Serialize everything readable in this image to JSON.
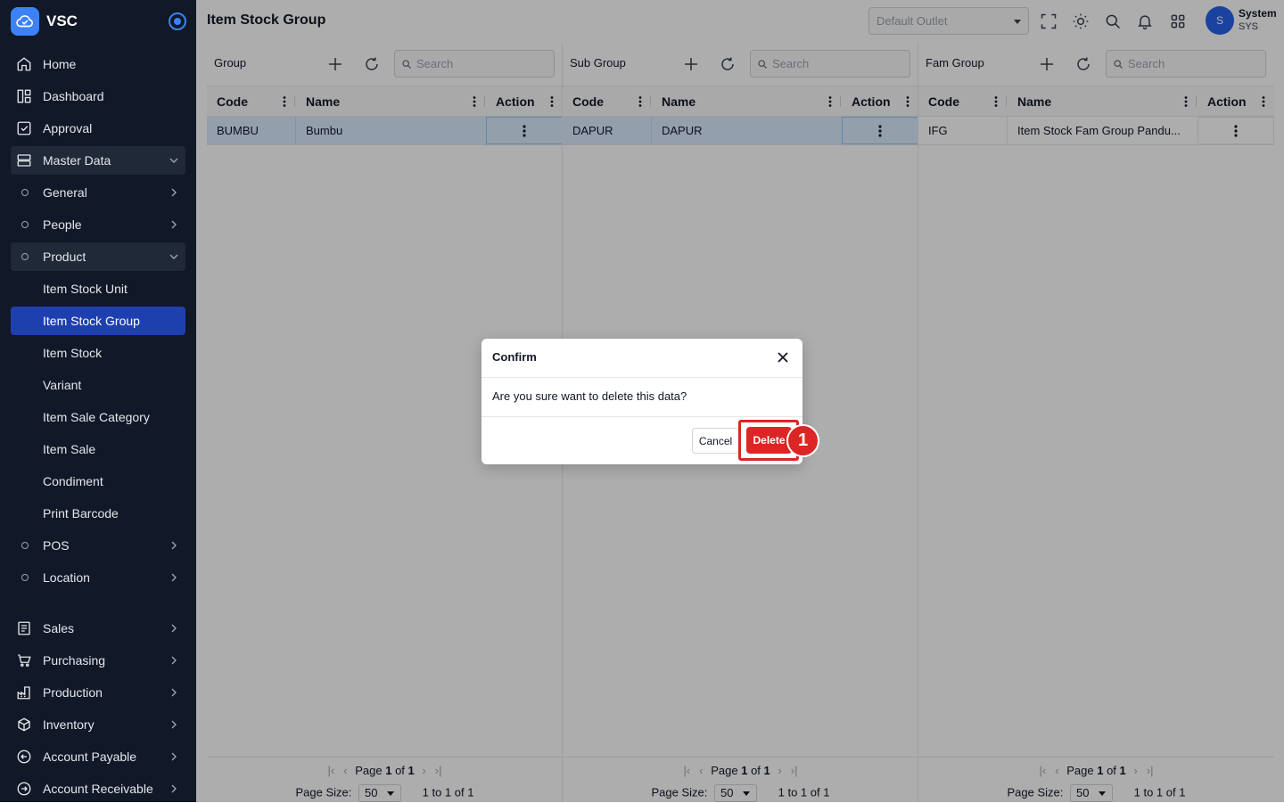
{
  "app": {
    "name": "VSC"
  },
  "sidebar": {
    "items": [
      {
        "label": "Home",
        "icon": "home-icon"
      },
      {
        "label": "Dashboard",
        "icon": "dashboard-icon"
      },
      {
        "label": "Approval",
        "icon": "approval-icon"
      },
      {
        "label": "Master Data",
        "icon": "master-data-icon"
      },
      {
        "label": "General"
      },
      {
        "label": "People"
      },
      {
        "label": "Product"
      },
      {
        "label": "Item Stock Unit"
      },
      {
        "label": "Item Stock Group"
      },
      {
        "label": "Item Stock"
      },
      {
        "label": "Variant"
      },
      {
        "label": "Item Sale Category"
      },
      {
        "label": "Item Sale"
      },
      {
        "label": "Condiment"
      },
      {
        "label": "Print Barcode"
      },
      {
        "label": "POS"
      },
      {
        "label": "Location"
      },
      {
        "label": "Sales",
        "icon": "sales-icon"
      },
      {
        "label": "Purchasing",
        "icon": "cart-icon"
      },
      {
        "label": "Production",
        "icon": "production-icon"
      },
      {
        "label": "Inventory",
        "icon": "box-icon"
      },
      {
        "label": "Account Payable",
        "icon": "arrow-left-circle-icon"
      },
      {
        "label": "Account Receivable",
        "icon": "arrow-right-circle-icon"
      }
    ]
  },
  "header": {
    "title": "Item Stock Group",
    "outlet_placeholder": "Default Outlet",
    "user": {
      "initial": "S",
      "name": "System",
      "code": "SYS"
    }
  },
  "panels": [
    {
      "title": "Group",
      "search_placeholder": "Search",
      "columns": [
        "Code",
        "Name",
        "Action"
      ],
      "rows": [
        {
          "code": "BUMBU",
          "name": "Bumbu"
        }
      ],
      "pager": {
        "page_prefix": "Page",
        "page": "1",
        "of": "of",
        "total_pages": "1",
        "page_size_label": "Page Size:",
        "page_size": "50",
        "range": "1 to 1 of 1"
      }
    },
    {
      "title": "Sub Group",
      "search_placeholder": "Search",
      "columns": [
        "Code",
        "Name",
        "Action"
      ],
      "rows": [
        {
          "code": "DAPUR",
          "name": "DAPUR"
        }
      ],
      "pager": {
        "page_prefix": "Page",
        "page": "1",
        "of": "of",
        "total_pages": "1",
        "page_size_label": "Page Size:",
        "page_size": "50",
        "range": "1 to 1 of 1"
      }
    },
    {
      "title": "Fam Group",
      "search_placeholder": "Search",
      "columns": [
        "Code",
        "Name",
        "Action"
      ],
      "rows": [
        {
          "code": "IFG",
          "name": "Item Stock Fam Group Pandu..."
        }
      ],
      "pager": {
        "page_prefix": "Page",
        "page": "1",
        "of": "of",
        "total_pages": "1",
        "page_size_label": "Page Size:",
        "page_size": "50",
        "range": "1 to 1 of 1"
      }
    }
  ],
  "modal": {
    "title": "Confirm",
    "message": "Are you sure want to delete this data?",
    "cancel_label": "Cancel",
    "delete_label": "Delete",
    "step_badge": "1"
  },
  "colors": {
    "sidebar_bg": "#111827",
    "active_item": "#1e40af",
    "danger": "#dc2626",
    "accent": "#3b82f6"
  }
}
